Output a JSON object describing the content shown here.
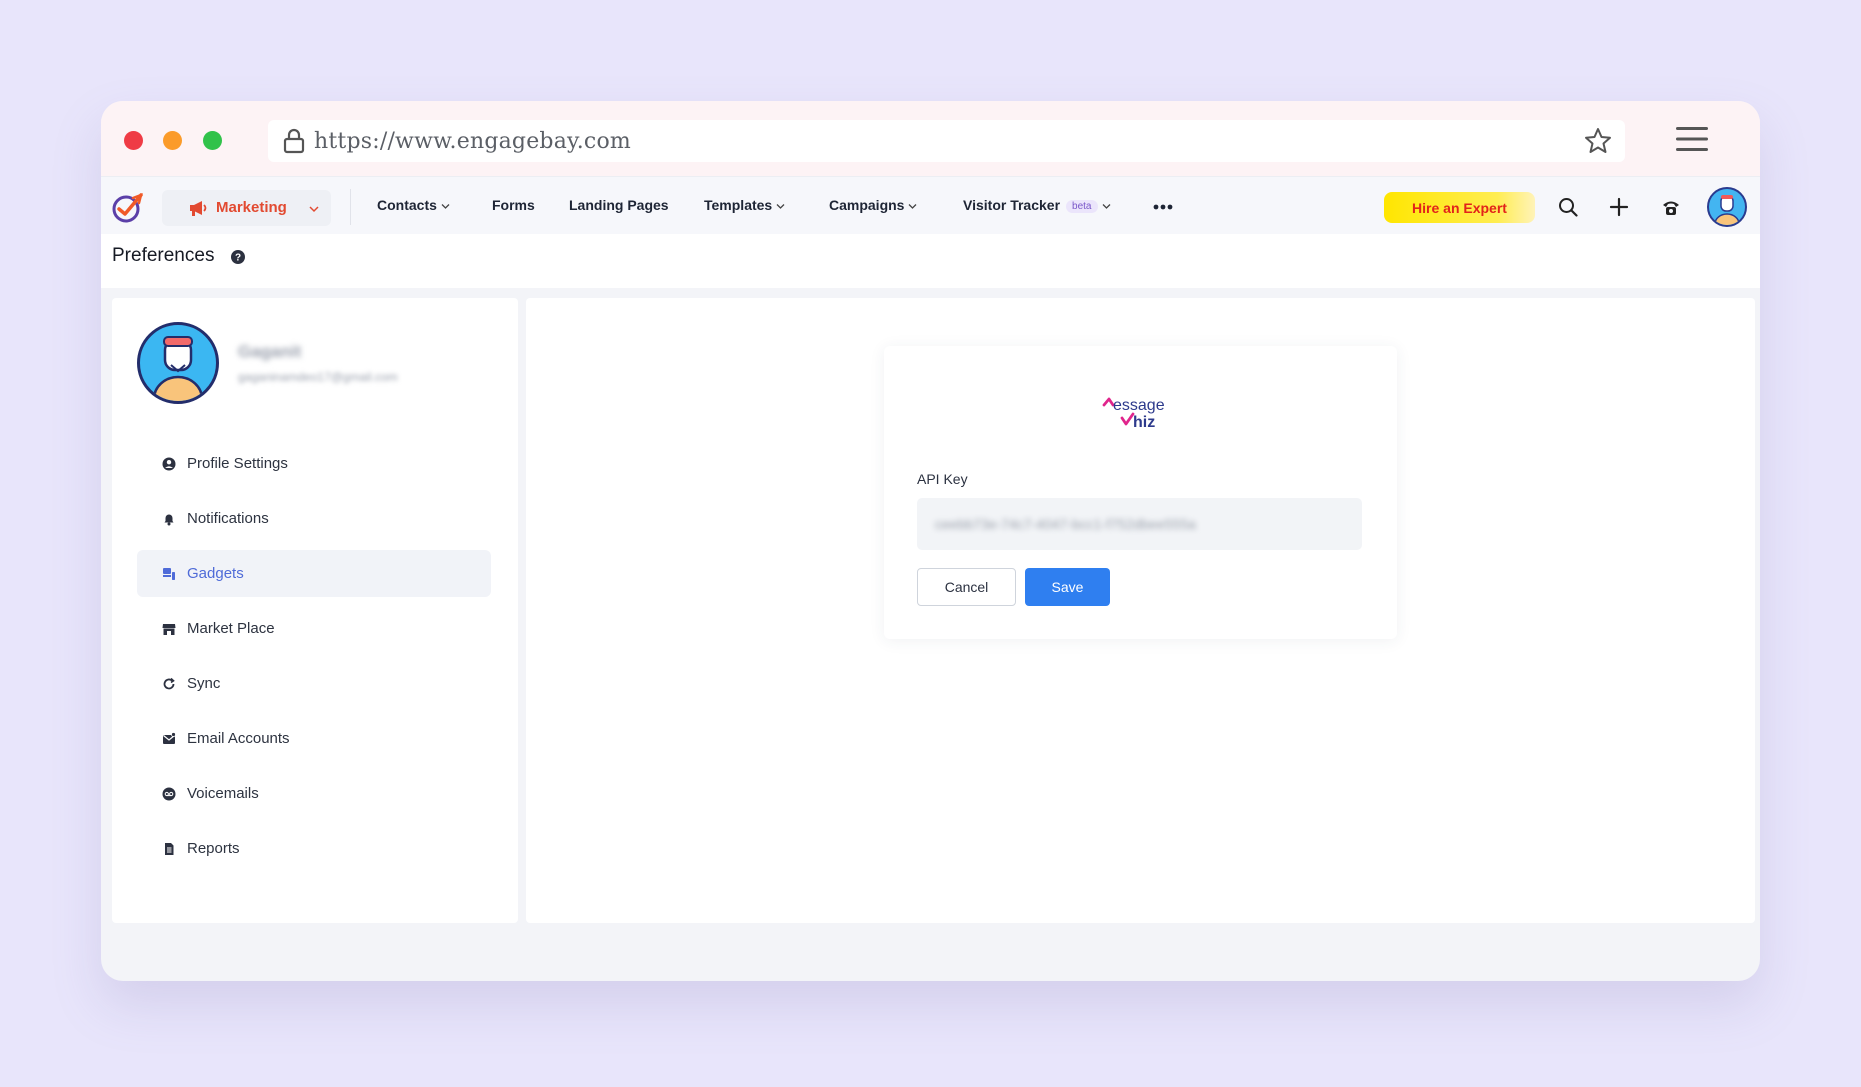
{
  "browser": {
    "url": "https://www.engagebay.com"
  },
  "navbar": {
    "module_label": "Marketing",
    "items": [
      {
        "label": "Contacts",
        "dropdown": true
      },
      {
        "label": "Forms",
        "dropdown": false
      },
      {
        "label": "Landing Pages",
        "dropdown": false
      },
      {
        "label": "Templates",
        "dropdown": true
      },
      {
        "label": "Campaigns",
        "dropdown": true
      },
      {
        "label": "Visitor Tracker",
        "dropdown": true,
        "badge": "beta"
      }
    ],
    "hire_label": "Hire an Expert"
  },
  "page": {
    "title": "Preferences"
  },
  "profile": {
    "name": "Gaganit",
    "email": "gaganinamdeo17@gmail.com"
  },
  "sidebar": {
    "items": [
      {
        "label": "Profile Settings",
        "icon": "user-circle-icon",
        "active": false
      },
      {
        "label": "Notifications",
        "icon": "bell-icon",
        "active": false
      },
      {
        "label": "Gadgets",
        "icon": "gadget-icon",
        "active": true
      },
      {
        "label": "Market Place",
        "icon": "store-icon",
        "active": false
      },
      {
        "label": "Sync",
        "icon": "sync-icon",
        "active": false
      },
      {
        "label": "Email Accounts",
        "icon": "email-icon",
        "active": false
      },
      {
        "label": "Voicemails",
        "icon": "voicemail-icon",
        "active": false
      },
      {
        "label": "Reports",
        "icon": "report-icon",
        "active": false
      }
    ]
  },
  "gadget_form": {
    "api_label": "API Key",
    "api_value": "ceebb73e-74c7-4047-bcc1-f752dbee555a",
    "cancel_label": "Cancel",
    "save_label": "Save"
  },
  "colors": {
    "accent": "#2f7ff0",
    "marketing": "#e24a31",
    "hire_bg": "#ffe600",
    "hire_text": "#e2231a"
  }
}
